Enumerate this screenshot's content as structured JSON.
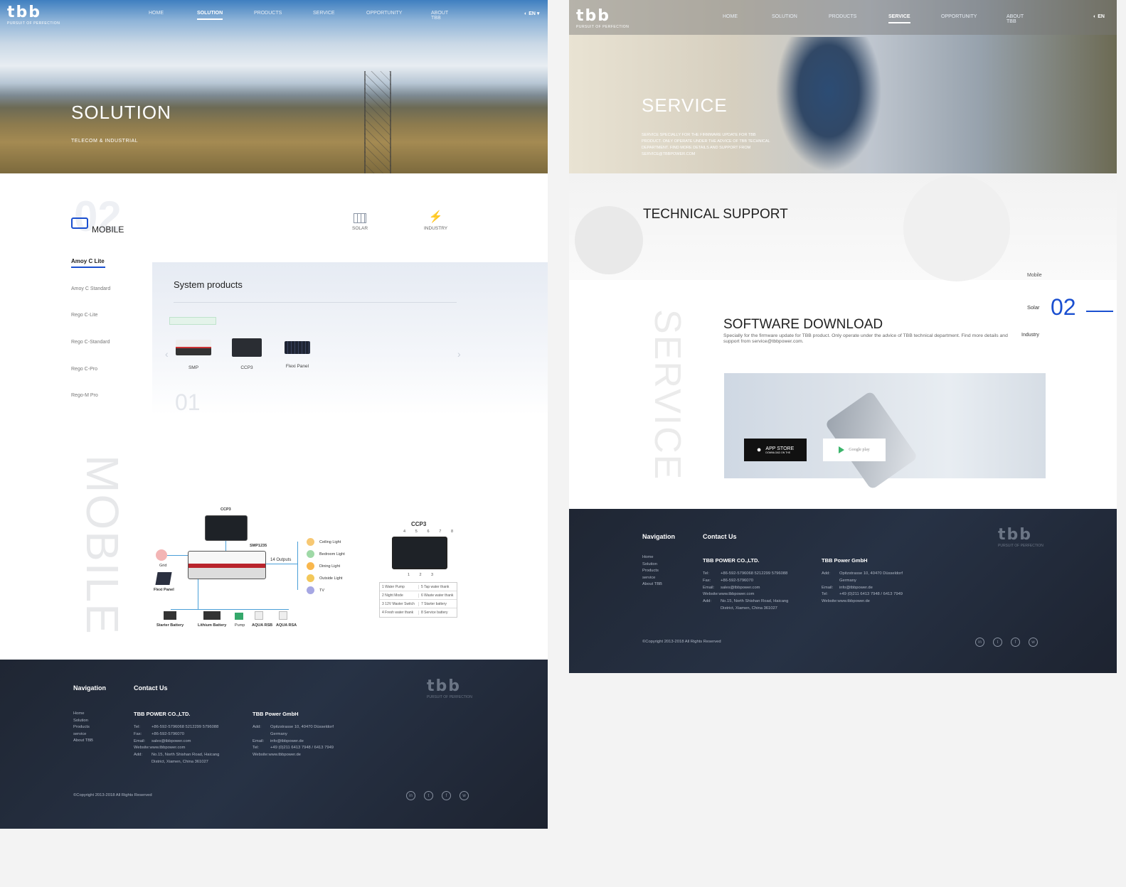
{
  "brand": {
    "logo": "tbb",
    "tagline": "PURSUIT OF PERFECTION"
  },
  "nav": [
    "HOME",
    "SOLUTION",
    "PRODUCTS",
    "SERVICE",
    "OPPORTUNITY",
    "ABOUT TBB"
  ],
  "lang": "EN",
  "left": {
    "hero_title": "SOLUTION",
    "hero_sub": "TELECOM & INDUSTRIAL",
    "big_num": "02",
    "tab_mobile": "MOBILE",
    "tab_solar": "SOLAR",
    "tab_industry": "INDUSTRY",
    "side_items": [
      "Amoy C Lite",
      "Amoy C Standard",
      "Rego C-Lite",
      "Rego C-Standard",
      "Rego C-Pro",
      "Rego-M Pro"
    ],
    "sys_title": "System products",
    "products": [
      "SMP",
      "CCP3",
      "Flexi Panel"
    ],
    "num01": "01",
    "vertical": "MOBILE",
    "diagram": {
      "ccp3_top": "CCP3",
      "smp": "SMP1235",
      "outputs": "14 Outputs",
      "grid": "Grid",
      "flexi": "Flexi Panel",
      "loads": [
        "Ceiling Light",
        "Bedroom Light",
        "Dining Light",
        "Outside Light",
        "TV"
      ],
      "bottom": [
        "Starter Battery",
        "Lithium Battery",
        "Pump",
        "AQUA RSB",
        "AQUA RSA"
      ],
      "ccp3_right": "CCP3",
      "ccp3_nums": [
        "4",
        "5",
        "6",
        "7",
        "8",
        "1",
        "2",
        "3"
      ],
      "table": [
        [
          "1  Water Pump",
          "5  Tap water thank"
        ],
        [
          "2  Night Mode",
          "6  Waste water thank"
        ],
        [
          "3  12V Master Switch",
          "7  Starter battery"
        ],
        [
          "4  Fresh water thank",
          "8  Service battery"
        ]
      ]
    }
  },
  "footer": {
    "nav_title": "Navigation",
    "contact_title": "Contact Us",
    "nav_items": [
      "Home",
      "Solution",
      "Products",
      "service",
      "About TBB"
    ],
    "co1": "TBB POWER CO.,LTD.",
    "co1_rows": [
      [
        "Tel:",
        "+86-592-5796068 5212299 5796088"
      ],
      [
        "Fax:",
        "+86-592-5796070"
      ],
      [
        "Email:",
        "sales@tbbpower.com"
      ],
      [
        "Website:",
        "www.tbbpower.com"
      ],
      [
        "Add:",
        "No.15, North Shishan Road, Haicang"
      ],
      [
        "",
        "District, Xiamen, China 361027"
      ]
    ],
    "co2": "TBB Power GmbH",
    "co2_rows": [
      [
        "Add:",
        "Opitzstrasse 10, 40470 Düsseldorf"
      ],
      [
        "",
        "Germany"
      ],
      [
        "Email:",
        "info@tbbpower.de"
      ],
      [
        "Tel:",
        "+49 (0)211 6413 7948 / 6413 7949"
      ],
      [
        "Website:",
        "www.tbbpower.de"
      ]
    ],
    "copyright": "©Copyright 2013-2018 All Rights Reserved",
    "social": [
      "in",
      "t",
      "f",
      "w"
    ]
  },
  "right": {
    "hero_title": "SERVICE",
    "hero_desc": "SERVICE SPECIALLY FOR THE FIRMWARE UPDATE FOR TBB PRODUCT. ONLY OPERATE UNDER THE ADVICE OF TBB TECHNICAL DEPARTMENT. FIND MORE DETAILS AND SUPPORT FROM SERVICE@TBBPOWER.COM",
    "ts_title": "TECHNICAL SUPPORT",
    "vertical": "SERVICE",
    "side_mobile": "Mobile",
    "side_solar": "Solar",
    "side_industry": "Industry",
    "num02": "02",
    "sd_title": "SOFTWARE DOWNLOAD",
    "sd_desc": "Specially for the firmware update for TBB product. Only operate under the advice of TBB technical department. Find more details and support from service@tbbpower.com.",
    "app_store": "APP STORE",
    "app_store_sub": "DOWNLOAD ON THE",
    "google_play": "Google play"
  },
  "colors": {
    "accent": "#1a4fd0",
    "footer_bg": "#222a38"
  }
}
